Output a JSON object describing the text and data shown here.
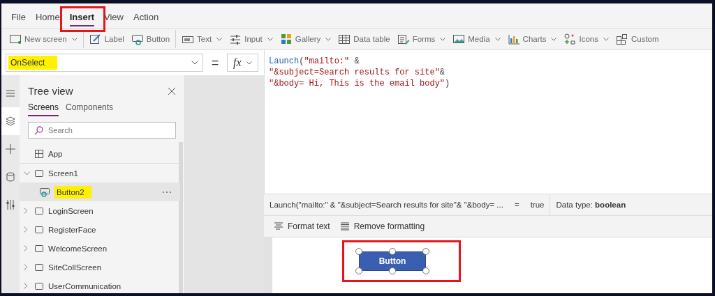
{
  "menu": [
    {
      "label": "File",
      "selected": false,
      "annotated": false
    },
    {
      "label": "Home",
      "selected": false,
      "annotated": false
    },
    {
      "label": "Insert",
      "selected": true,
      "annotated": true
    },
    {
      "label": "View",
      "selected": false,
      "annotated": false
    },
    {
      "label": "Action",
      "selected": false,
      "annotated": false
    }
  ],
  "toolbar": [
    {
      "label": "New screen",
      "dropdown": true,
      "divider_after": true
    },
    {
      "label": "Label",
      "dropdown": false,
      "divider_after": false
    },
    {
      "label": "Button",
      "dropdown": false,
      "divider_after": true
    },
    {
      "label": "Text",
      "dropdown": true,
      "divider_after": false
    },
    {
      "label": "Input",
      "dropdown": true,
      "divider_after": false
    },
    {
      "label": "Gallery",
      "dropdown": true,
      "divider_after": false
    },
    {
      "label": "Data table",
      "dropdown": false,
      "divider_after": false
    },
    {
      "label": "Forms",
      "dropdown": true,
      "divider_after": false
    },
    {
      "label": "Media",
      "dropdown": true,
      "divider_after": false
    },
    {
      "label": "Charts",
      "dropdown": true,
      "divider_after": false
    },
    {
      "label": "Icons",
      "dropdown": true,
      "divider_after": false
    },
    {
      "label": "Custom",
      "dropdown": false,
      "divider_after": false
    }
  ],
  "formula_bar": {
    "property": "OnSelect",
    "property_highlighted": true,
    "equals": "=",
    "fx": "fx",
    "code": [
      [
        {
          "kind": "function",
          "text": "Launch"
        },
        {
          "kind": "operator",
          "text": "("
        },
        {
          "kind": "string",
          "text": "\"mailto:\""
        },
        {
          "kind": "operator",
          "text": " &"
        }
      ],
      [
        {
          "kind": "string",
          "text": "\"&subject=Search results for site\""
        },
        {
          "kind": "operator",
          "text": "&"
        }
      ],
      [
        {
          "kind": "string",
          "text": "\"&body= Hi, This is the email body\""
        },
        {
          "kind": "operator",
          "text": ")"
        }
      ]
    ],
    "result": {
      "expression": "Launch(\"mailto:\" & \"&subject=Search results for site\"& \"&body= ...",
      "equals": "=",
      "value": "true",
      "data_type": "Data type: **boolean**"
    },
    "format_buttons": [
      "Format text",
      "Remove formatting"
    ]
  },
  "rail": [
    {
      "selected": false
    },
    {
      "selected": true
    },
    {
      "selected": false
    },
    {
      "selected": false
    },
    {
      "selected": false
    }
  ],
  "tree_view": {
    "title": "Tree view",
    "tabs": [
      {
        "label": "Screens",
        "selected": true
      },
      {
        "label": "Components",
        "selected": false
      }
    ],
    "search": {
      "placeholder": "Search"
    },
    "items": [
      {
        "kind": "app",
        "label": "App",
        "selected": false,
        "highlighted": false
      },
      {
        "kind": "screen",
        "label": "Screen1",
        "expanded": true,
        "selected": false,
        "highlighted": false,
        "children": [
          {
            "kind": "button",
            "label": "Button2",
            "selected": true,
            "highlighted": true
          }
        ]
      },
      {
        "kind": "screen",
        "label": "LoginScreen",
        "expanded": false,
        "selected": false,
        "highlighted": false
      },
      {
        "kind": "screen",
        "label": "RegisterFace",
        "expanded": false,
        "selected": false,
        "highlighted": false
      },
      {
        "kind": "screen",
        "label": "WelcomeScreen",
        "expanded": false,
        "selected": false,
        "highlighted": false
      },
      {
        "kind": "screen",
        "label": "SiteCollScreen",
        "expanded": false,
        "selected": false,
        "highlighted": false
      },
      {
        "kind": "screen",
        "label": "UserCommunication",
        "expanded": false,
        "selected": false,
        "highlighted": false
      }
    ]
  },
  "canvas": {
    "button": {
      "label": "Button",
      "selected": true,
      "annotated": true
    }
  }
}
